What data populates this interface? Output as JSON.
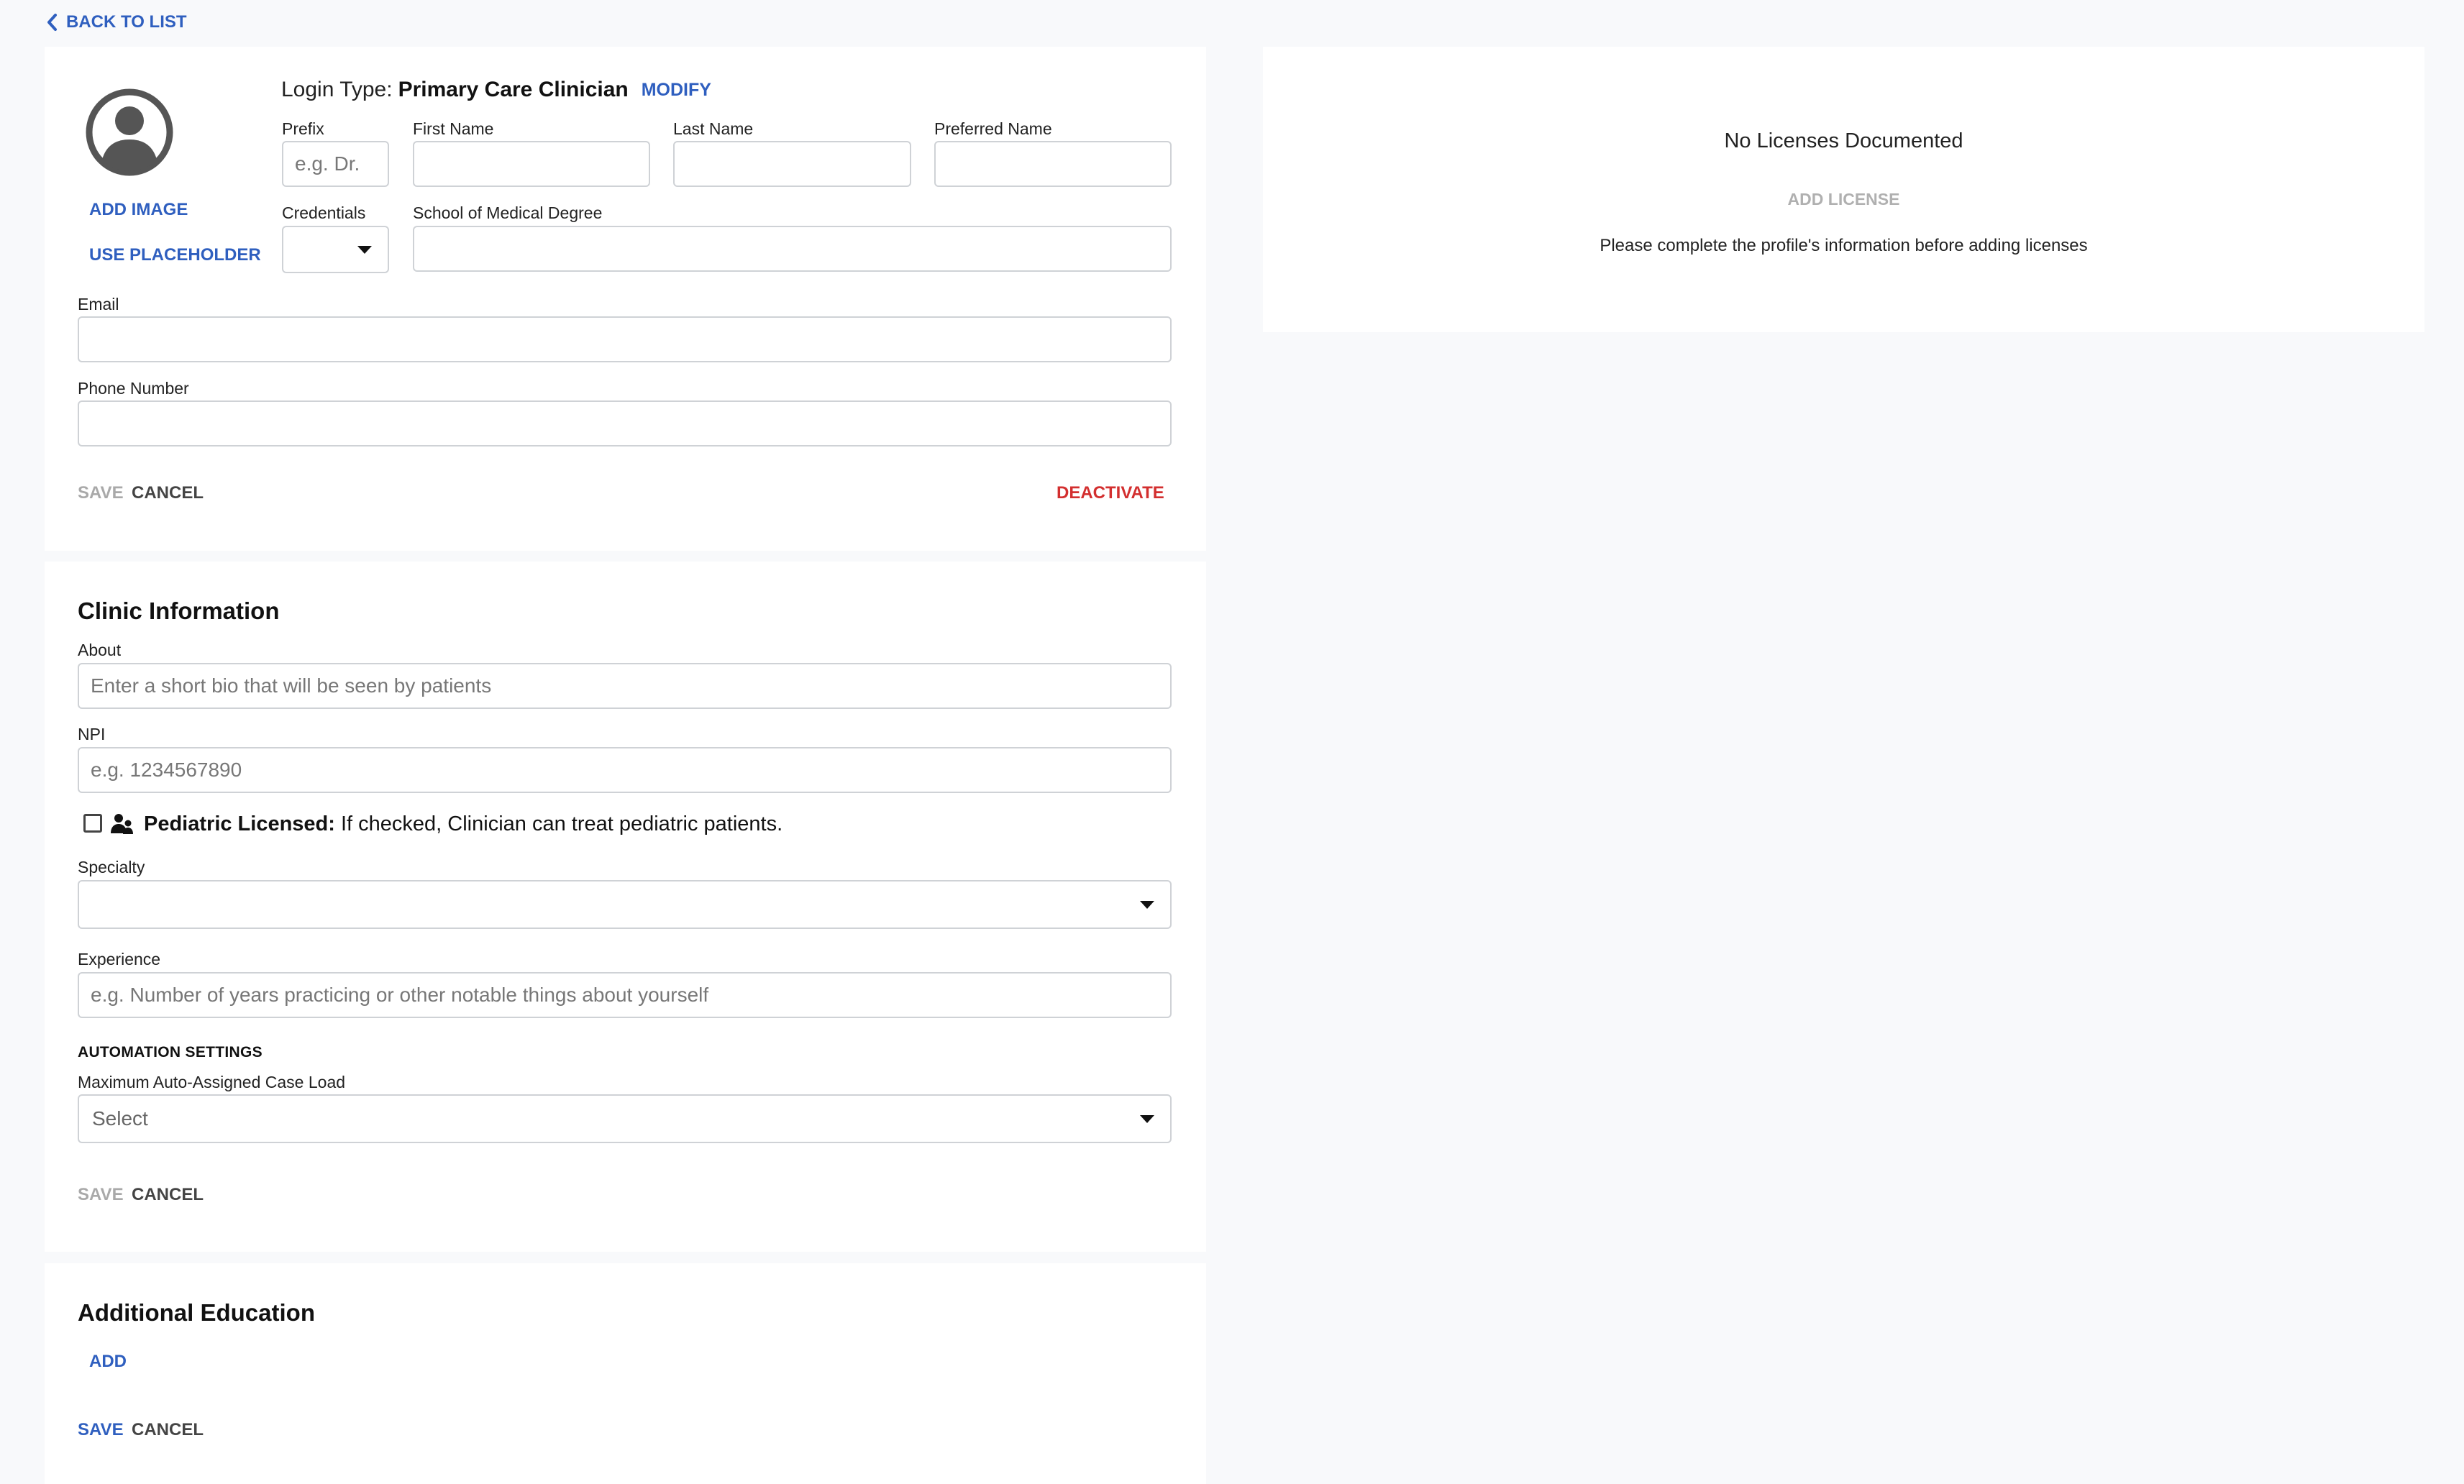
{
  "nav": {
    "back_label": "BACK TO LIST"
  },
  "profile": {
    "add_image": "ADD IMAGE",
    "use_placeholder": "USE PLACEHOLDER",
    "login_type_label": "Login Type:",
    "login_type_value": "Primary Care Clinician",
    "modify_label": "MODIFY",
    "prefix": {
      "label": "Prefix",
      "placeholder": "e.g. Dr.",
      "value": ""
    },
    "first_name": {
      "label": "First Name",
      "value": ""
    },
    "last_name": {
      "label": "Last Name",
      "value": ""
    },
    "preferred_name": {
      "label": "Preferred Name",
      "value": ""
    },
    "credentials": {
      "label": "Credentials",
      "value": ""
    },
    "school": {
      "label": "School of Medical Degree",
      "value": ""
    },
    "email": {
      "label": "Email",
      "value": ""
    },
    "phone": {
      "label": "Phone Number",
      "value": ""
    },
    "save_label": "SAVE",
    "cancel_label": "CANCEL",
    "deactivate_label": "DEACTIVATE"
  },
  "clinic": {
    "title": "Clinic Information",
    "about": {
      "label": "About",
      "placeholder": "Enter a short bio that will be seen by patients"
    },
    "npi": {
      "label": "NPI",
      "placeholder": "e.g. 1234567890"
    },
    "pediatric": {
      "bold": "Pediatric Licensed:",
      "text": "If checked, Clinician can treat pediatric patients.",
      "checked": false
    },
    "specialty": {
      "label": "Specialty",
      "value": ""
    },
    "experience": {
      "label": "Experience",
      "placeholder": "e.g. Number of years practicing or other notable things about yourself"
    },
    "automation_heading": "AUTOMATION SETTINGS",
    "case_load": {
      "label": "Maximum Auto-Assigned Case Load",
      "value": "Select"
    },
    "save_label": "SAVE",
    "cancel_label": "CANCEL"
  },
  "education": {
    "title": "Additional Education",
    "add_label": "ADD",
    "save_label": "SAVE",
    "cancel_label": "CANCEL"
  },
  "licenses": {
    "empty_title": "No Licenses Documented",
    "add_label": "ADD LICENSE",
    "note": "Please complete the profile's information before adding licenses"
  },
  "colors": {
    "accent": "#2f5fbf",
    "danger": "#d32f2f",
    "disabled": "#a9a9a9",
    "background": "#f8f9fb"
  },
  "icons": [
    "chevron-left-icon",
    "user-avatar-icon",
    "caret-down-icon",
    "pediatric-icon"
  ]
}
